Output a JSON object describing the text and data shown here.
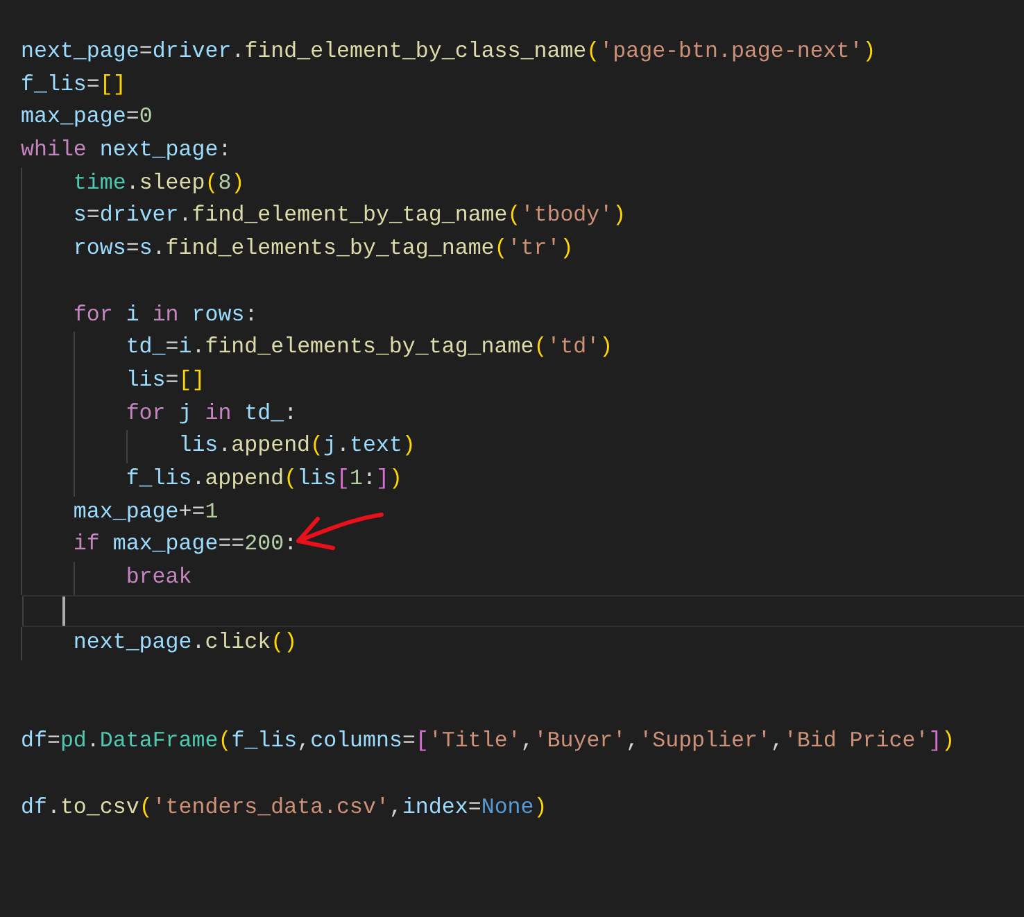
{
  "editor": {
    "lines": [
      {
        "kind": "code",
        "tokens": [
          {
            "text": "next_page",
            "kind": "var"
          },
          {
            "text": "=",
            "kind": "op"
          },
          {
            "text": "driver",
            "kind": "var"
          },
          {
            "text": ".",
            "kind": "op"
          },
          {
            "text": "find_element_by_class_name",
            "kind": "fn"
          },
          {
            "text": "(",
            "kind": "b1"
          },
          {
            "text": "'page-btn.page-next'",
            "kind": "str"
          },
          {
            "text": ")",
            "kind": "b1"
          }
        ]
      },
      {
        "kind": "code",
        "tokens": [
          {
            "text": "f_lis",
            "kind": "var"
          },
          {
            "text": "=",
            "kind": "op"
          },
          {
            "text": "[]",
            "kind": "b1"
          }
        ]
      },
      {
        "kind": "code",
        "tokens": [
          {
            "text": "max_page",
            "kind": "var"
          },
          {
            "text": "=",
            "kind": "op"
          },
          {
            "text": "0",
            "kind": "num"
          }
        ]
      },
      {
        "kind": "code",
        "tokens": [
          {
            "text": "while",
            "kind": "kw"
          },
          {
            "text": " next_page",
            "kind": "var"
          },
          {
            "text": ":",
            "kind": "op"
          }
        ],
        "children": [
          {
            "kind": "code",
            "tokens": [
              {
                "text": "time",
                "kind": "cls"
              },
              {
                "text": ".",
                "kind": "op"
              },
              {
                "text": "sleep",
                "kind": "fn"
              },
              {
                "text": "(",
                "kind": "b1"
              },
              {
                "text": "8",
                "kind": "num"
              },
              {
                "text": ")",
                "kind": "b1"
              }
            ]
          },
          {
            "kind": "code",
            "tokens": [
              {
                "text": "s",
                "kind": "var"
              },
              {
                "text": "=",
                "kind": "op"
              },
              {
                "text": "driver",
                "kind": "var"
              },
              {
                "text": ".",
                "kind": "op"
              },
              {
                "text": "find_element_by_tag_name",
                "kind": "fn"
              },
              {
                "text": "(",
                "kind": "b1"
              },
              {
                "text": "'tbody'",
                "kind": "str"
              },
              {
                "text": ")",
                "kind": "b1"
              }
            ]
          },
          {
            "kind": "code",
            "tokens": [
              {
                "text": "rows",
                "kind": "var"
              },
              {
                "text": "=",
                "kind": "op"
              },
              {
                "text": "s",
                "kind": "var"
              },
              {
                "text": ".",
                "kind": "op"
              },
              {
                "text": "find_elements_by_tag_name",
                "kind": "fn"
              },
              {
                "text": "(",
                "kind": "b1"
              },
              {
                "text": "'tr'",
                "kind": "str"
              },
              {
                "text": ")",
                "kind": "b1"
              }
            ]
          },
          {
            "kind": "blank"
          },
          {
            "kind": "code",
            "tokens": [
              {
                "text": "for",
                "kind": "kw"
              },
              {
                "text": " i ",
                "kind": "var"
              },
              {
                "text": "in",
                "kind": "kw"
              },
              {
                "text": " rows",
                "kind": "var"
              },
              {
                "text": ":",
                "kind": "op"
              }
            ],
            "children": [
              {
                "kind": "code",
                "tokens": [
                  {
                    "text": "td_",
                    "kind": "var"
                  },
                  {
                    "text": "=",
                    "kind": "op"
                  },
                  {
                    "text": "i",
                    "kind": "var"
                  },
                  {
                    "text": ".",
                    "kind": "op"
                  },
                  {
                    "text": "find_elements_by_tag_name",
                    "kind": "fn"
                  },
                  {
                    "text": "(",
                    "kind": "b1"
                  },
                  {
                    "text": "'td'",
                    "kind": "str"
                  },
                  {
                    "text": ")",
                    "kind": "b1"
                  }
                ]
              },
              {
                "kind": "code",
                "tokens": [
                  {
                    "text": "lis",
                    "kind": "var"
                  },
                  {
                    "text": "=",
                    "kind": "op"
                  },
                  {
                    "text": "[]",
                    "kind": "b1"
                  }
                ]
              },
              {
                "kind": "code",
                "tokens": [
                  {
                    "text": "for",
                    "kind": "kw"
                  },
                  {
                    "text": " j ",
                    "kind": "var"
                  },
                  {
                    "text": "in",
                    "kind": "kw"
                  },
                  {
                    "text": " td_",
                    "kind": "var"
                  },
                  {
                    "text": ":",
                    "kind": "op"
                  }
                ],
                "children": [
                  {
                    "kind": "code",
                    "tokens": [
                      {
                        "text": "lis",
                        "kind": "var"
                      },
                      {
                        "text": ".",
                        "kind": "op"
                      },
                      {
                        "text": "append",
                        "kind": "fn"
                      },
                      {
                        "text": "(",
                        "kind": "b1"
                      },
                      {
                        "text": "j",
                        "kind": "var"
                      },
                      {
                        "text": ".",
                        "kind": "op"
                      },
                      {
                        "text": "text",
                        "kind": "var"
                      },
                      {
                        "text": ")",
                        "kind": "b1"
                      }
                    ]
                  }
                ]
              },
              {
                "kind": "code",
                "tokens": [
                  {
                    "text": "f_lis",
                    "kind": "var"
                  },
                  {
                    "text": ".",
                    "kind": "op"
                  },
                  {
                    "text": "append",
                    "kind": "fn"
                  },
                  {
                    "text": "(",
                    "kind": "b1"
                  },
                  {
                    "text": "lis",
                    "kind": "var"
                  },
                  {
                    "text": "[",
                    "kind": "b2"
                  },
                  {
                    "text": "1",
                    "kind": "num"
                  },
                  {
                    "text": ":",
                    "kind": "op"
                  },
                  {
                    "text": "]",
                    "kind": "b2"
                  },
                  {
                    "text": ")",
                    "kind": "b1"
                  }
                ]
              }
            ]
          },
          {
            "kind": "code",
            "tokens": [
              {
                "text": "max_page",
                "kind": "var"
              },
              {
                "text": "+=",
                "kind": "op"
              },
              {
                "text": "1",
                "kind": "num"
              }
            ]
          },
          {
            "kind": "code",
            "tokens": [
              {
                "text": "if",
                "kind": "kw"
              },
              {
                "text": " max_page",
                "kind": "var"
              },
              {
                "text": "==",
                "kind": "op"
              },
              {
                "text": "200",
                "kind": "num"
              },
              {
                "text": ":",
                "kind": "op"
              }
            ],
            "children": [
              {
                "kind": "code",
                "tokens": [
                  {
                    "text": "break",
                    "kind": "kw"
                  }
                ]
              }
            ]
          },
          {
            "kind": "cursor"
          },
          {
            "kind": "code",
            "tokens": [
              {
                "text": "next_page",
                "kind": "var"
              },
              {
                "text": ".",
                "kind": "op"
              },
              {
                "text": "click",
                "kind": "fn"
              },
              {
                "text": "()",
                "kind": "b1"
              }
            ]
          }
        ]
      },
      {
        "kind": "blank"
      },
      {
        "kind": "blank"
      },
      {
        "kind": "code",
        "tokens": [
          {
            "text": "df",
            "kind": "var"
          },
          {
            "text": "=",
            "kind": "op"
          },
          {
            "text": "pd",
            "kind": "cls"
          },
          {
            "text": ".",
            "kind": "op"
          },
          {
            "text": "DataFrame",
            "kind": "cls"
          },
          {
            "text": "(",
            "kind": "b1"
          },
          {
            "text": "f_lis",
            "kind": "var"
          },
          {
            "text": ",",
            "kind": "op"
          },
          {
            "text": "columns",
            "kind": "var"
          },
          {
            "text": "=",
            "kind": "op"
          },
          {
            "text": "[",
            "kind": "b2"
          },
          {
            "text": "'Title'",
            "kind": "str"
          },
          {
            "text": ",",
            "kind": "op"
          },
          {
            "text": "'Buyer'",
            "kind": "str"
          },
          {
            "text": ",",
            "kind": "op"
          },
          {
            "text": "'Supplier'",
            "kind": "str"
          },
          {
            "text": ",",
            "kind": "op"
          },
          {
            "text": "'Bid Price'",
            "kind": "str"
          },
          {
            "text": "]",
            "kind": "b2"
          },
          {
            "text": ")",
            "kind": "b1"
          }
        ]
      },
      {
        "kind": "blank"
      },
      {
        "kind": "code",
        "tokens": [
          {
            "text": "df",
            "kind": "var"
          },
          {
            "text": ".",
            "kind": "op"
          },
          {
            "text": "to_csv",
            "kind": "fn"
          },
          {
            "text": "(",
            "kind": "b1"
          },
          {
            "text": "'tenders_data.csv'",
            "kind": "str"
          },
          {
            "text": ",",
            "kind": "op"
          },
          {
            "text": "index",
            "kind": "var"
          },
          {
            "text": "=",
            "kind": "op"
          },
          {
            "text": "None",
            "kind": "const"
          },
          {
            "text": ")",
            "kind": "b1"
          }
        ]
      }
    ]
  }
}
